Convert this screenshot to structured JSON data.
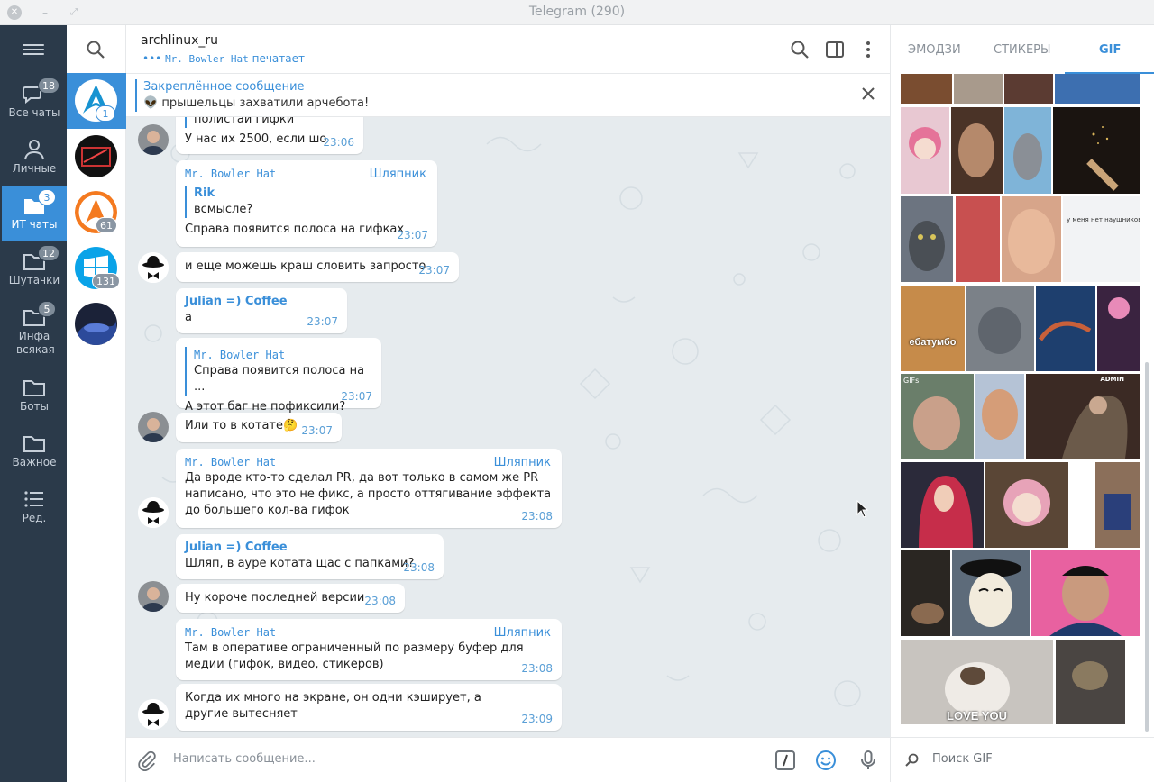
{
  "window": {
    "title": "Telegram (290)"
  },
  "folders": [
    {
      "label": "Все чаты",
      "badge": "18",
      "icon": "chat-bubbles-icon"
    },
    {
      "label": "Личные",
      "badge": "",
      "icon": "person-icon"
    },
    {
      "label": "ИТ чаты",
      "badge": "3",
      "icon": "folder-icon",
      "active": true
    },
    {
      "label": "Шутачки",
      "badge": "12",
      "icon": "folder-icon"
    },
    {
      "label": "Инфа всякая",
      "badge": "5",
      "icon": "folder-icon"
    },
    {
      "label": "Боты",
      "badge": "",
      "icon": "folder-icon"
    },
    {
      "label": "Важное",
      "badge": "",
      "icon": "folder-icon"
    },
    {
      "label": "Ред.",
      "badge": "",
      "icon": "list-edit-icon"
    }
  ],
  "chats": [
    {
      "badge": "1",
      "active": true
    },
    {
      "badge": ""
    },
    {
      "badge": "61"
    },
    {
      "badge": "131"
    },
    {
      "badge": ""
    }
  ],
  "header": {
    "name": "archlinux_ru",
    "typing_dots": "•••",
    "typing_user": "Mr. Bowler Hat",
    "typing_text": "печатает"
  },
  "pinned": {
    "title": "Закреплённое сообщение",
    "text": "👽 прышельцы захватили арчебота!"
  },
  "messages": {
    "m1": {
      "quote_tail": "полистай гифки",
      "text": "У нас их 2500, если шо",
      "time": "23:06"
    },
    "m2": {
      "sender": "Mr. Bowler Hat",
      "rank": "Шляпник",
      "reply_name": "Rik",
      "reply_text": "всмысле?",
      "text": "Справа появится полоса на гифках",
      "time": "23:07"
    },
    "m3": {
      "text": "и еще можешь краш словить запросто",
      "time": "23:07"
    },
    "m4": {
      "sender": "Julian =) Coffee",
      "text": "а",
      "time": "23:07"
    },
    "m5": {
      "reply_name": "Mr. Bowler Hat",
      "reply_text": "Справа появится полоса на ...",
      "text": "А этот баг не пофиксили?",
      "time": "23:07"
    },
    "m6": {
      "text": "Или то в котате🤔",
      "time": "23:07"
    },
    "m7": {
      "sender": "Mr. Bowler Hat",
      "rank": "Шляпник",
      "text": "Да вроде кто-то сделал PR, да вот только в самом же PR написано, что это не фикс, а просто оттягивание эффекта до большего кол-ва гифок",
      "time": "23:08"
    },
    "m8": {
      "sender": "Julian =) Coffee",
      "text": "Шляп, в ауре котата щас с папками?",
      "time": "23:08"
    },
    "m9": {
      "text": "Ну короче последней версии",
      "time": "23:08"
    },
    "m10": {
      "sender": "Mr. Bowler Hat",
      "rank": "Шляпник",
      "text": "Там в оперативе ограниченный по размеру буфер для медии (гифок, видео, стикеров)",
      "time": "23:08"
    },
    "m11": {
      "text": "Когда их много на экране, он одни кэширует, а другие вытесняет",
      "time": "23:09"
    }
  },
  "composer": {
    "placeholder": "Написать сообщение..."
  },
  "sidepanel": {
    "tabs": [
      "ЭМОДЗИ",
      "СТИКЕРЫ",
      "GIF"
    ],
    "active_tab": "GIF",
    "gif_captions": {
      "g_last": "LOVE YOU",
      "g_stamp": "GIFs",
      "g_admin": "ADMIN",
      "g_meme": "ебатумбо",
      "g_note": "у меня нет наушников, так ч"
    },
    "search_placeholder": "Поиск GIF"
  },
  "colors": {
    "accent": "#3a8fd9",
    "sidebar": "#2b3a4a",
    "chat_bg": "#e6ebee"
  }
}
